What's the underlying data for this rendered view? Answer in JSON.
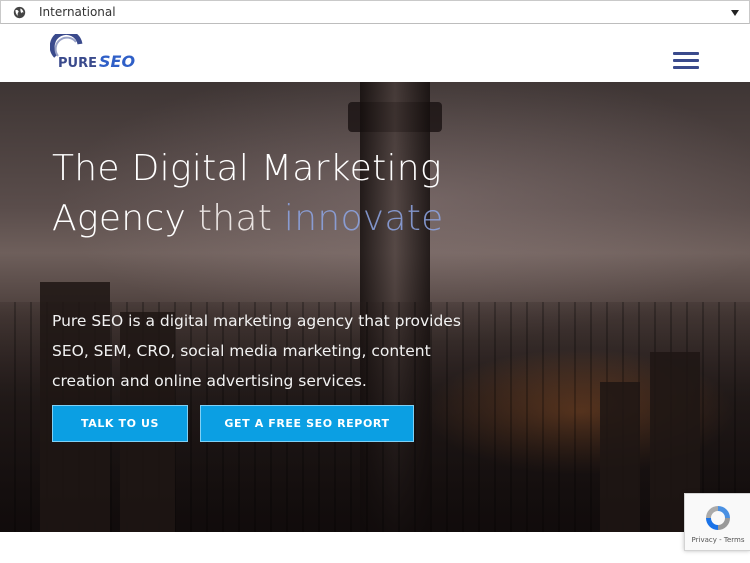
{
  "region_bar": {
    "label": "International"
  },
  "header": {
    "logo_text_a": "PURE",
    "logo_text_b": "SEO"
  },
  "hero": {
    "title_line1": "The Digital Marketing",
    "title_line2_a": "Agency",
    "title_line2_b": "that",
    "title_line2_c": "innovate",
    "description": "Pure SEO is a digital marketing agency that provides SEO, SEM, CRO, social media marketing, content creation and online advertising services.",
    "buttons": {
      "talk": "TALK TO US",
      "report": "GET A FREE SEO REPORT"
    }
  },
  "recaptcha": {
    "label": "Privacy - Terms"
  },
  "colors": {
    "accent": "#0b9fe3",
    "brand_navy": "#3a4a8c"
  },
  "icons": {
    "region": "globe-icon",
    "dropdown": "chevron-down-icon",
    "menu": "hamburger-menu-icon"
  }
}
